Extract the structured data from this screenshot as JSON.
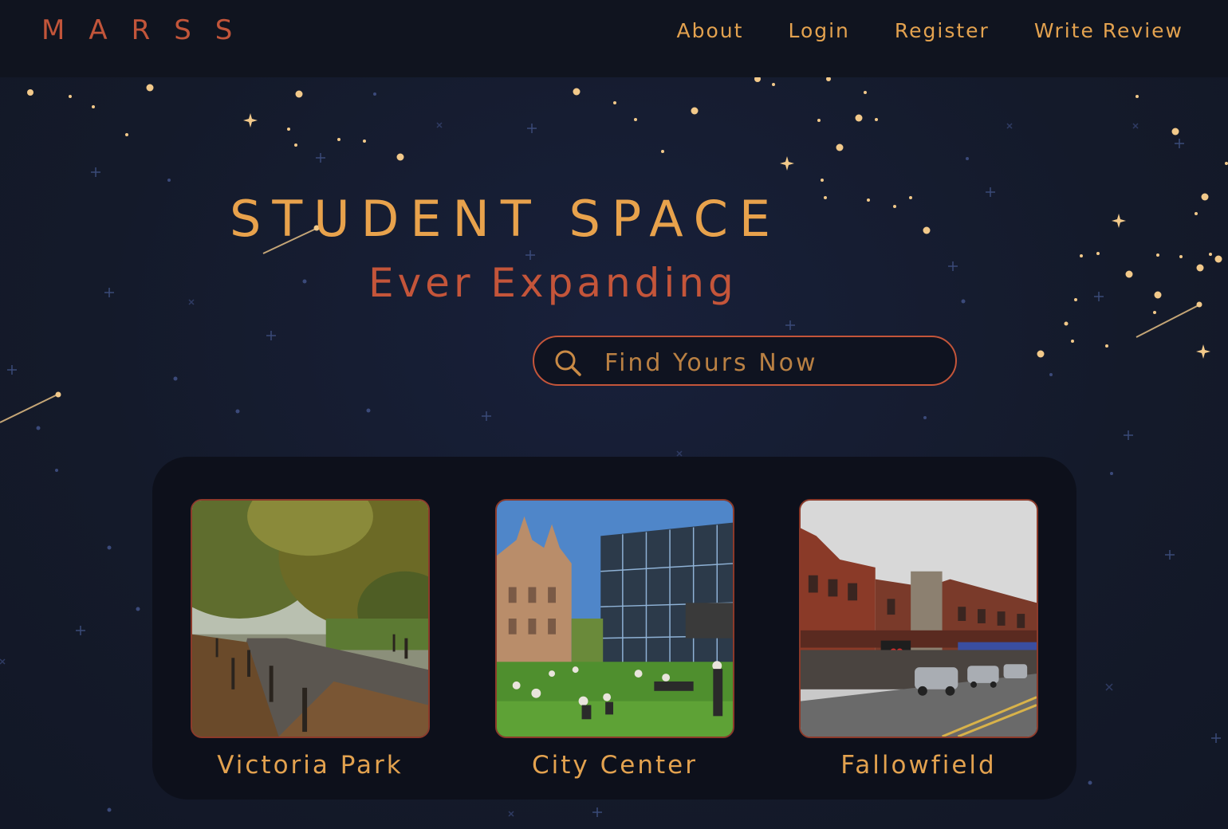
{
  "brand": {
    "logo": "MARSS"
  },
  "nav": {
    "links": [
      "About",
      "Login",
      "Register",
      "Write Review"
    ]
  },
  "hero": {
    "title": "STUDENT SPACE",
    "subtitle": "Ever Expanding"
  },
  "search": {
    "placeholder": "Find Yours Now",
    "icon": "search-icon"
  },
  "areas": [
    {
      "label": "Victoria Park",
      "image": "tree-lined-path-photo"
    },
    {
      "label": "City Center",
      "image": "university-campus-lawn-photo"
    },
    {
      "label": "Fallowfield",
      "image": "high-street-shops-photo"
    }
  ],
  "colors": {
    "background": "#141a2a",
    "navbar": "#10141f",
    "accent_orange": "#e8a24c",
    "accent_red": "#c4553a",
    "panel": "#0d101b"
  }
}
